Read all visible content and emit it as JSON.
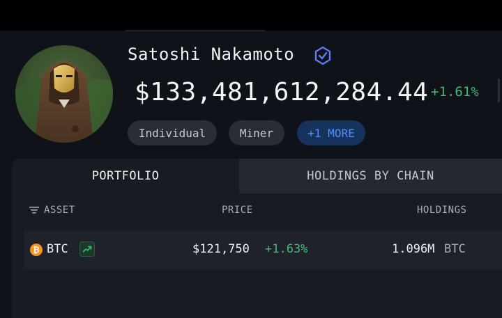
{
  "profile": {
    "name": "Satoshi Nakamoto",
    "verified_icon": "verified-badge-icon",
    "total_value": "$133,481,612,284.44",
    "change": "+1.61%",
    "tags": [
      "Individual",
      "Miner"
    ],
    "more_tag": "+1 MORE"
  },
  "tabs": {
    "portfolio": "PORTFOLIO",
    "holdings_by_chain": "HOLDINGS BY CHAIN"
  },
  "table": {
    "headers": {
      "asset": "ASSET",
      "price": "PRICE",
      "holdings": "HOLDINGS"
    },
    "rows": [
      {
        "asset": "BTC",
        "price": "$121,750",
        "change": "+1.63%",
        "holdings": "1.096M",
        "unit": "BTC"
      }
    ]
  },
  "colors": {
    "positive": "#3fb97a",
    "bitcoin": "#f7931a",
    "more_tag": "#4f8ff7",
    "background": "#0f1218"
  }
}
